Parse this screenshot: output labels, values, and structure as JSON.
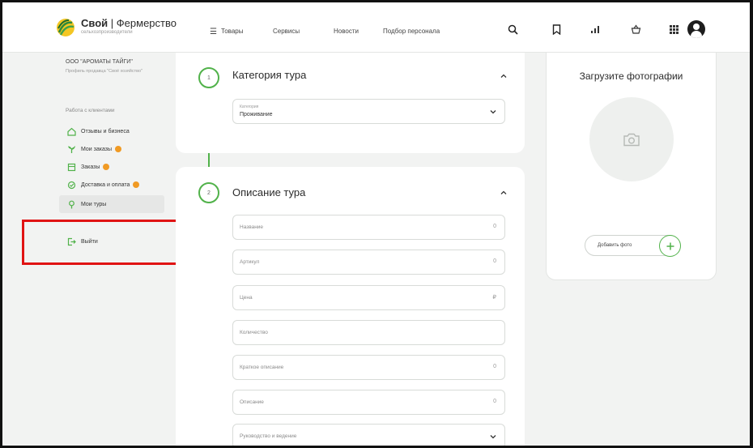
{
  "header": {
    "brand_name": "Свой",
    "brand_divider": "|",
    "brand_tail": "Фермерство",
    "brand_sub": "сельхозпроизводители",
    "nav": {
      "goods": "Товары",
      "services": "Сервисы",
      "news": "Новости",
      "staff": "Подбор персонала"
    },
    "icons": [
      "search-icon",
      "bookmark-icon",
      "chart-icon",
      "basket-icon",
      "grid-icon",
      "avatar-icon"
    ]
  },
  "sidebar": {
    "company_name": "ООО \"АРОМАТЫ ТАЙГИ\"",
    "company_desc": "Профиль продавца \"Своё хозяйство\"",
    "section_title": "Работа с клиентами",
    "items": [
      {
        "label": "Отзывы и бизнеса",
        "icon": "home-icon",
        "badge": false
      },
      {
        "label": "Мои заказы",
        "icon": "sprout-icon",
        "badge": true
      },
      {
        "label": "Заказы",
        "icon": "box-icon",
        "badge": true
      },
      {
        "label": "Доставка и оплата",
        "icon": "delivery-icon",
        "badge": true
      },
      {
        "label": "Мои туры",
        "icon": "tour-icon",
        "badge": false
      }
    ],
    "logout_label": "Выйти"
  },
  "steps": [
    "1",
    "2"
  ],
  "category_card": {
    "title": "Категория тура",
    "select_label": "Категория",
    "select_value": "Проживание"
  },
  "description_card": {
    "title": "Описание тура",
    "fields": [
      {
        "placeholder": "Название",
        "suffix": "0"
      },
      {
        "placeholder": "Артикул",
        "suffix": "0"
      },
      {
        "placeholder": "Цена",
        "suffix": "₽"
      },
      {
        "placeholder": "Количество",
        "suffix": ""
      },
      {
        "placeholder": "Краткое описание",
        "suffix": "0"
      },
      {
        "placeholder": "Описание",
        "suffix": "0"
      },
      {
        "placeholder": "Руководство и ведение",
        "suffix": ""
      }
    ]
  },
  "photo_card": {
    "title": "Загрузите фотографии",
    "add_label": "Добавить фото"
  },
  "colors": {
    "accent": "#51b24a",
    "badge": "#f09a24",
    "highlight": "#e01313"
  }
}
